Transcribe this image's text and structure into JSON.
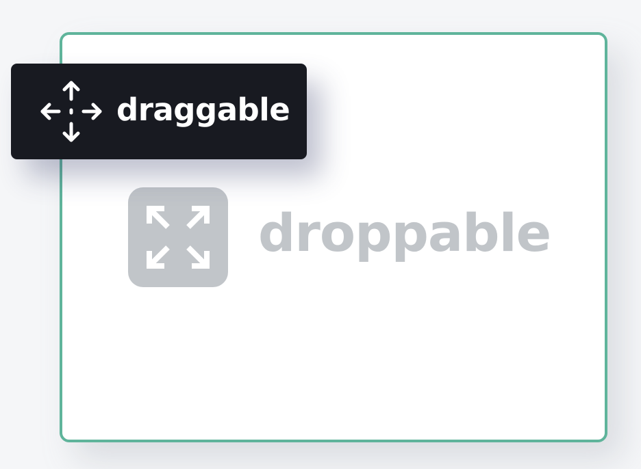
{
  "droppable": {
    "label": "droppable",
    "icon": "expand-icon",
    "border_color": "#5fb49b",
    "muted_color": "#c1c5c9"
  },
  "draggable": {
    "label": "draggable",
    "icon": "move-icon",
    "background_color": "#181a21",
    "text_color": "#ffffff"
  }
}
